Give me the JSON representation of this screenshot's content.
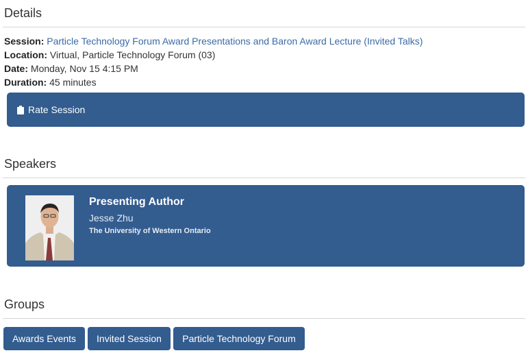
{
  "details": {
    "title": "Details",
    "session_label": "Session:",
    "session_value": "Particle Technology Forum Award Presentations and Baron Award Lecture (Invited Talks)",
    "location_label": "Location:",
    "location_value": "Virtual, Particle Technology Forum (03)",
    "date_label": "Date:",
    "date_value": "Monday, Nov 15 4:15 PM",
    "duration_label": "Duration:",
    "duration_value": "45 minutes",
    "rate_button": "Rate Session"
  },
  "speakers": {
    "title": "Speakers",
    "items": [
      {
        "role": "Presenting Author",
        "name": "Jesse Zhu",
        "organization": "The University of Western Ontario"
      }
    ]
  },
  "groups": {
    "title": "Groups",
    "items": [
      "Awards Events",
      "Invited Session",
      "Particle Technology Forum"
    ]
  },
  "colors": {
    "accent": "#335c8f",
    "link": "#3a6aa7"
  },
  "icons": {
    "rate": "clipboard-icon"
  }
}
